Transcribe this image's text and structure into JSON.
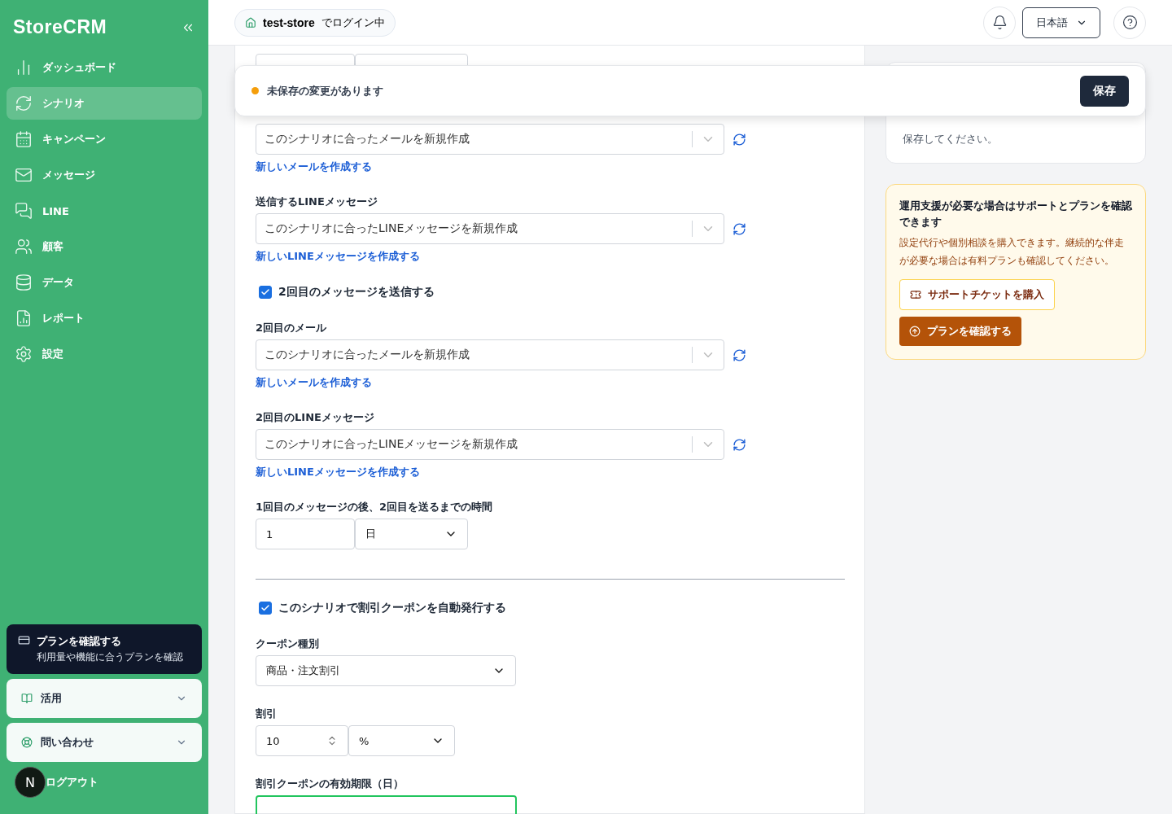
{
  "sidebar": {
    "logo": "StoreCRM",
    "items": [
      {
        "label": "ダッシュボード",
        "selected": false
      },
      {
        "label": "シナリオ",
        "selected": true
      },
      {
        "label": "キャンペーン",
        "selected": false
      },
      {
        "label": "メッセージ",
        "selected": false
      },
      {
        "label": "LINE",
        "selected": false
      },
      {
        "label": "顧客",
        "selected": false
      },
      {
        "label": "データ",
        "selected": false
      },
      {
        "label": "レポート",
        "selected": false
      },
      {
        "label": "設定",
        "selected": false
      }
    ],
    "plan_card": {
      "title": "プランを確認する",
      "subtitle": "利用量や機能に合うプランを確認"
    },
    "sections": [
      {
        "label": "活用",
        "expanded": false
      },
      {
        "label": "問い合わせ",
        "expanded": false
      }
    ],
    "avatar": "N",
    "logout": "ログアウト"
  },
  "header": {
    "store": "test-store",
    "login_suffix": "でログイン中",
    "language": "日本語"
  },
  "unsaved_bar": {
    "message": "未保存の変更があります",
    "save": "保存"
  },
  "form": [
    {
      "kind": "pair"
    },
    {
      "kind": "picker",
      "value": "このシナリオに合ったメールを新規作成",
      "link": "新しいメールを作成する"
    },
    {
      "kind": "picker",
      "label": "送信するLINEメッセージ",
      "value": "このシナリオに合ったLINEメッセージを新規作成",
      "link": "新しいLINEメッセージを作成する"
    },
    {
      "kind": "checkbox",
      "label": "2回目のメッセージを送信する",
      "checked": true
    },
    {
      "kind": "picker",
      "label": "2回目のメール",
      "value": "このシナリオに合ったメールを新規作成",
      "link": "新しいメールを作成する"
    },
    {
      "kind": "picker",
      "label": "2回目のLINEメッセージ",
      "value": "このシナリオに合ったLINEメッセージを新規作成",
      "link": "新しいLINEメッセージを作成する"
    },
    {
      "kind": "pair",
      "label": "1回目のメッセージの後、2回目を送るまでの時間",
      "value": "1",
      "unit": "日"
    },
    {
      "kind": "divider"
    },
    {
      "kind": "checkbox",
      "label": "このシナリオで割引クーポンを自動発行する",
      "checked": true
    },
    {
      "kind": "select",
      "label": "クーポン種別",
      "value": "商品・注文割引"
    },
    {
      "kind": "number",
      "label": "割引",
      "value": "10",
      "unit": "%"
    },
    {
      "kind": "input",
      "label": "割引クーポンの有効期限（日）",
      "focused": true
    }
  ],
  "info_card": {
    "text": "保存してください。"
  },
  "support_card": {
    "title": "運用支援が必要な場合はサポートとプランを確認できます",
    "text": "設定代行や個別相談を購入できます。継続的な伴走が必要な場合は有料プランも確認してください。",
    "ticket_button": "サポートチケットを購入",
    "plan_button": "プランを確認する"
  }
}
